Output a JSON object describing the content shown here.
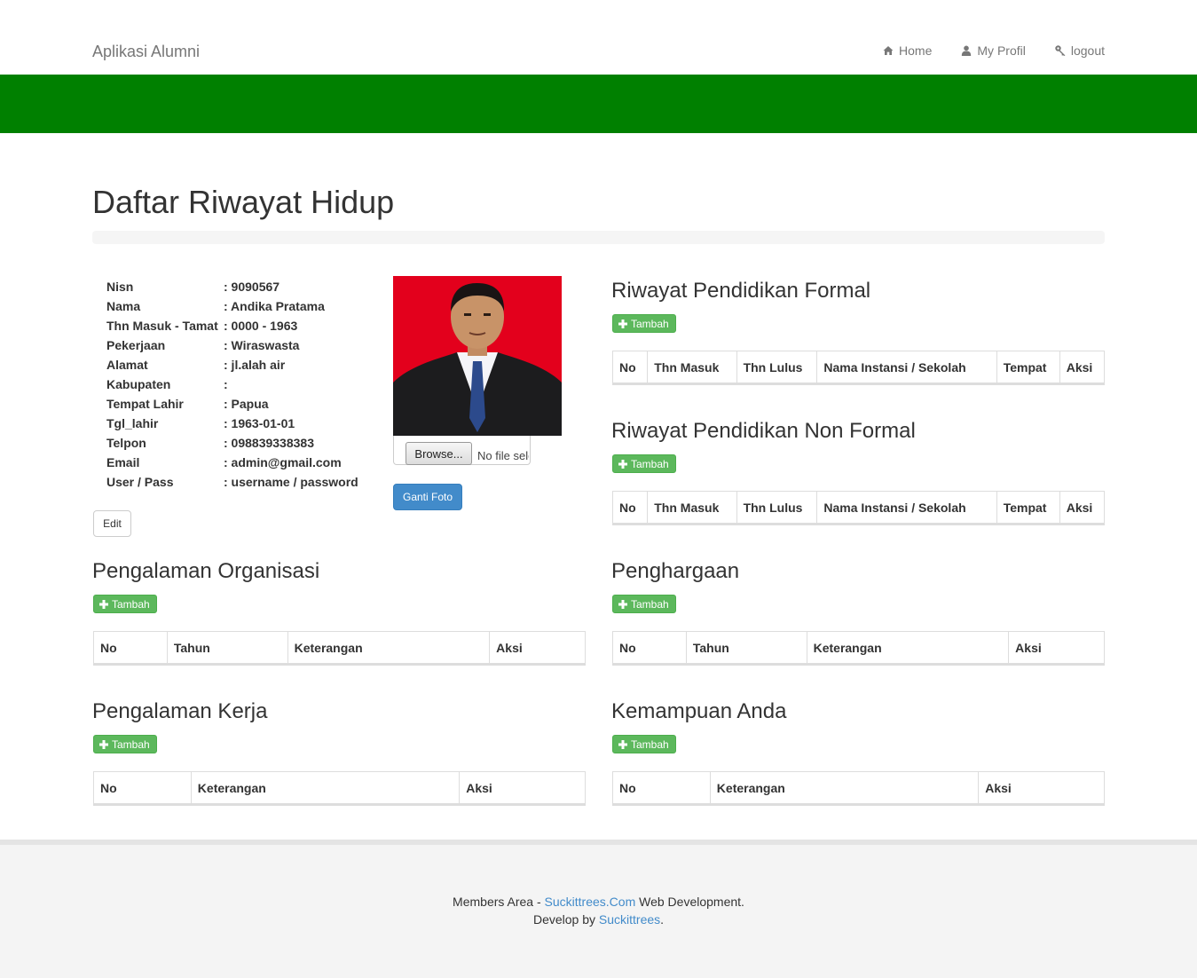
{
  "navbar": {
    "brand": "Aplikasi Alumni",
    "links": [
      {
        "label": "Home",
        "icon": "home-icon"
      },
      {
        "label": "My Profil",
        "icon": "user-icon"
      },
      {
        "label": "logout",
        "icon": "key-icon"
      }
    ],
    "band_color": "#008000"
  },
  "page_title": "Daftar Riwayat Hidup",
  "profile": {
    "rows": [
      {
        "label": "Nisn",
        "value": ": 9090567"
      },
      {
        "label": "Nama",
        "value": ": Andika Pratama"
      },
      {
        "label": "Thn Masuk - Tamat",
        "value": ": 0000 - 1963"
      },
      {
        "label": "Pekerjaan",
        "value": ": Wiraswasta"
      },
      {
        "label": "Alamat",
        "value": ": jl.alah air"
      },
      {
        "label": "Kabupaten",
        "value": ":"
      },
      {
        "label": "Tempat Lahir",
        "value": ": Papua"
      },
      {
        "label": "Tgl_lahir",
        "value": ": 1963-01-01"
      },
      {
        "label": "Telpon",
        "value": ": 098839338383"
      },
      {
        "label": "Email",
        "value": ": admin@gmail.com"
      },
      {
        "label": "User / Pass",
        "value": ": username / password"
      }
    ],
    "edit_label": "Edit"
  },
  "photo_upload": {
    "browse_label": "Browse...",
    "file_status": "No file selected.",
    "submit_label": "Ganti Foto"
  },
  "sections": {
    "pendidikan_formal": {
      "title": "Riwayat Pendidikan Formal",
      "add_label": "Tambah",
      "columns": [
        "No",
        "Thn Masuk",
        "Thn Lulus",
        "Nama Instansi / Sekolah",
        "Tempat",
        "Aksi"
      ]
    },
    "pendidikan_non_formal": {
      "title": "Riwayat Pendidikan Non Formal",
      "add_label": "Tambah",
      "columns": [
        "No",
        "Thn Masuk",
        "Thn Lulus",
        "Nama Instansi / Sekolah",
        "Tempat",
        "Aksi"
      ]
    },
    "organisasi": {
      "title": "Pengalaman Organisasi",
      "add_label": "Tambah",
      "columns": [
        "No",
        "Tahun",
        "Keterangan",
        "Aksi"
      ]
    },
    "penghargaan": {
      "title": "Penghargaan",
      "add_label": "Tambah",
      "columns": [
        "No",
        "Tahun",
        "Keterangan",
        "Aksi"
      ]
    },
    "kerja": {
      "title": "Pengalaman Kerja",
      "add_label": "Tambah",
      "columns": [
        "No",
        "Keterangan",
        "Aksi"
      ]
    },
    "kemampuan": {
      "title": "Kemampuan Anda",
      "add_label": "Tambah",
      "columns": [
        "No",
        "Keterangan",
        "Aksi"
      ]
    }
  },
  "footer": {
    "line1_prefix": "Members Area - ",
    "line1_link": "Suckittrees.Com",
    "line1_suffix": " Web Development.",
    "line2_prefix": "Develop by ",
    "line2_link": "Suckittrees",
    "line2_suffix": "."
  }
}
